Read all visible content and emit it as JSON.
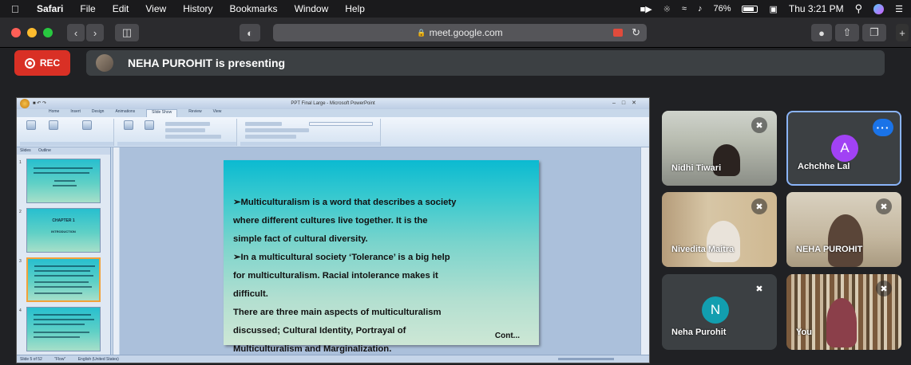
{
  "menubar": {
    "items": [
      "Safari",
      "File",
      "Edit",
      "View",
      "History",
      "Bookmarks",
      "Window",
      "Help"
    ],
    "battery": "76%",
    "clock": "Thu 3:21 PM"
  },
  "browser": {
    "url": "meet.google.com"
  },
  "meet": {
    "rec_label": "REC",
    "presenting_text": "NEHA PUROHIT is presenting"
  },
  "powerpoint": {
    "window_title": "PPT Final Large - Microsoft PowerPoint",
    "ribbon_tabs": [
      "Home",
      "Insert",
      "Design",
      "Animations",
      "Slide Show",
      "Review",
      "View"
    ],
    "panel_tabs": [
      "Slides",
      "Outline"
    ],
    "thumbnails": [
      {
        "num": "1",
        "text": ""
      },
      {
        "num": "2",
        "text": "CHAPTER 1"
      },
      {
        "num": "3",
        "text": ""
      },
      {
        "num": "4",
        "text": ""
      }
    ],
    "thumb2_sub": "INTRODUCTION",
    "status": [
      "Slide 5 of 52",
      "\"Flow\"",
      "English (United States)"
    ]
  },
  "slide": {
    "lines": [
      "➢Multiculturalism is a word that describes a society",
      "where different cultures live together. It is the",
      "simple fact of cultural diversity.",
      "➢In a multicultural society ‘Tolerance’ is a big help",
      "for multiculturalism. Racial intolerance makes it",
      "difficult.",
      "There are three main aspects of multiculturalism",
      "discussed; Cultural Identity, Portrayal of",
      "Multiculturalism and Marginalization."
    ],
    "cont": "Cont..."
  },
  "participants": [
    {
      "name": "Nidhi Tiwari"
    },
    {
      "name": "Achchhe Lal",
      "initial": "A",
      "color": "#a142f4"
    },
    {
      "name": "Nivedita Maitra"
    },
    {
      "name": "NEHA PUROHIT"
    },
    {
      "name": "Neha Purohit",
      "initial": "N",
      "color": "#129eaf"
    },
    {
      "name": "You"
    }
  ]
}
